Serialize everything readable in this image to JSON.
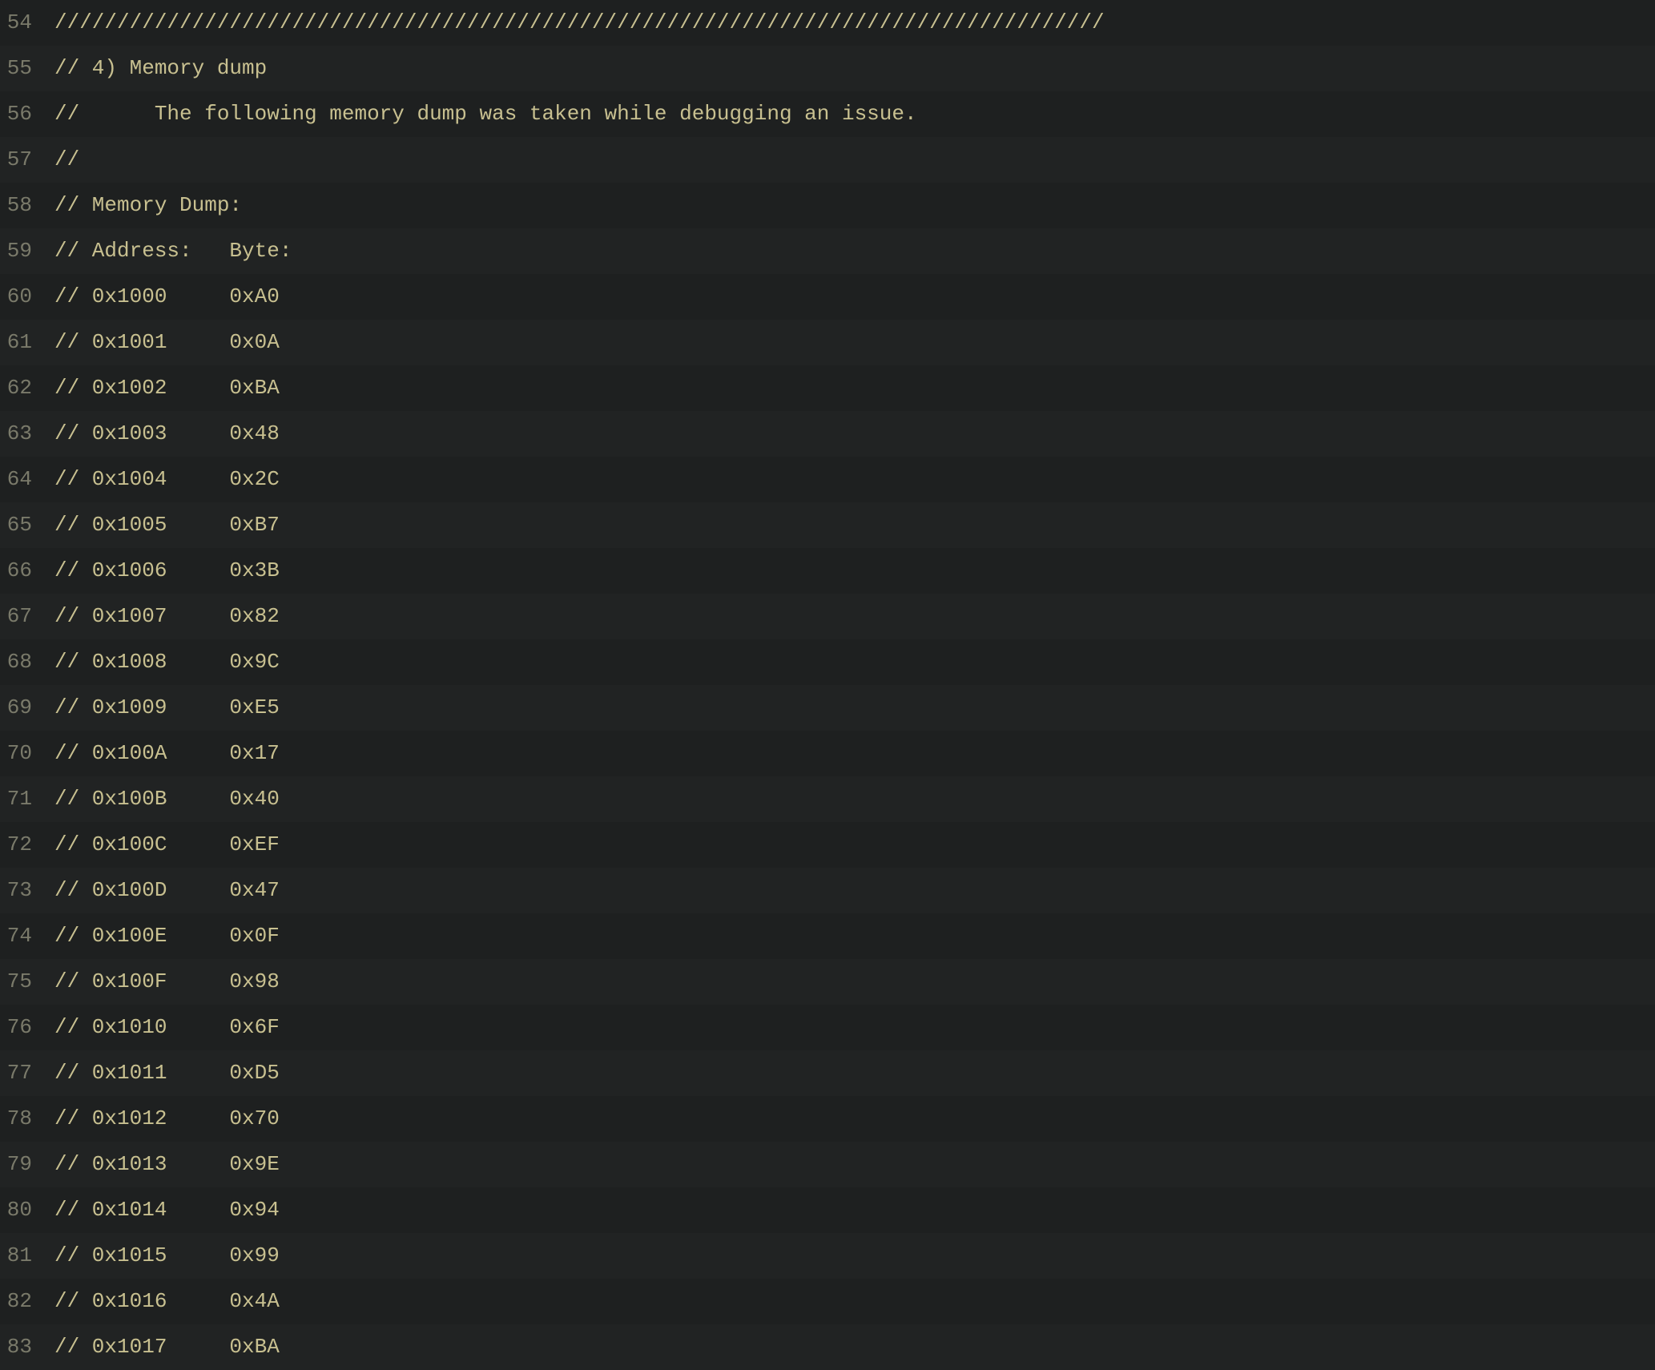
{
  "editor": {
    "background": "#1e2020",
    "text_color": "#c8c090",
    "line_number_color": "#7a7a6a",
    "lines": [
      {
        "num": 54,
        "content": "////////////////////////////////////////////////////////////////////////////////////"
      },
      {
        "num": 55,
        "content": "// 4) Memory dump"
      },
      {
        "num": 56,
        "content": "//      The following memory dump was taken while debugging an issue."
      },
      {
        "num": 57,
        "content": "//"
      },
      {
        "num": 58,
        "content": "// Memory Dump:"
      },
      {
        "num": 59,
        "content": "// Address:   Byte:"
      },
      {
        "num": 60,
        "content": "// 0x1000     0xA0"
      },
      {
        "num": 61,
        "content": "// 0x1001     0x0A"
      },
      {
        "num": 62,
        "content": "// 0x1002     0xBA"
      },
      {
        "num": 63,
        "content": "// 0x1003     0x48"
      },
      {
        "num": 64,
        "content": "// 0x1004     0x2C"
      },
      {
        "num": 65,
        "content": "// 0x1005     0xB7"
      },
      {
        "num": 66,
        "content": "// 0x1006     0x3B"
      },
      {
        "num": 67,
        "content": "// 0x1007     0x82"
      },
      {
        "num": 68,
        "content": "// 0x1008     0x9C"
      },
      {
        "num": 69,
        "content": "// 0x1009     0xE5"
      },
      {
        "num": 70,
        "content": "// 0x100A     0x17"
      },
      {
        "num": 71,
        "content": "// 0x100B     0x40"
      },
      {
        "num": 72,
        "content": "// 0x100C     0xEF"
      },
      {
        "num": 73,
        "content": "// 0x100D     0x47"
      },
      {
        "num": 74,
        "content": "// 0x100E     0x0F"
      },
      {
        "num": 75,
        "content": "// 0x100F     0x98"
      },
      {
        "num": 76,
        "content": "// 0x1010     0x6F"
      },
      {
        "num": 77,
        "content": "// 0x1011     0xD5"
      },
      {
        "num": 78,
        "content": "// 0x1012     0x70"
      },
      {
        "num": 79,
        "content": "// 0x1013     0x9E"
      },
      {
        "num": 80,
        "content": "// 0x1014     0x94"
      },
      {
        "num": 81,
        "content": "// 0x1015     0x99"
      },
      {
        "num": 82,
        "content": "// 0x1016     0x4A"
      },
      {
        "num": 83,
        "content": "// 0x1017     0xBA"
      }
    ]
  }
}
